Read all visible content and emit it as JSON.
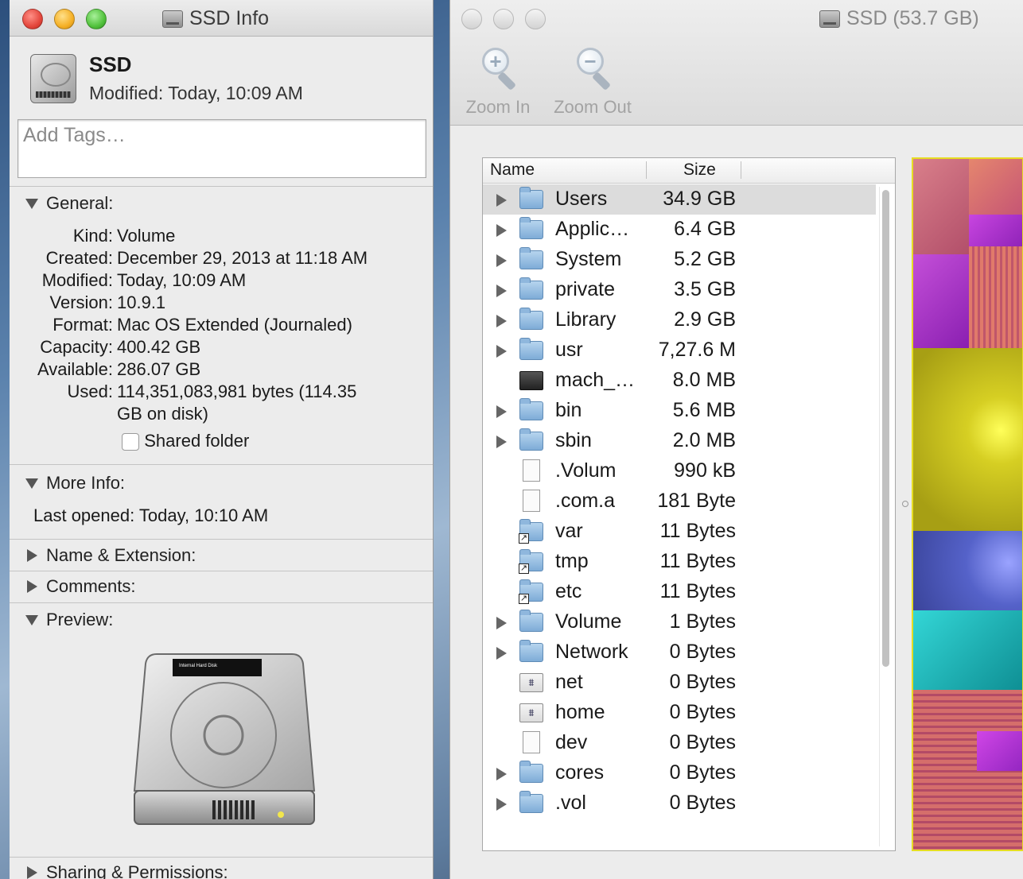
{
  "info_window": {
    "title": "SSD Info",
    "name": "SSD",
    "modified_header": "Modified: Today, 10:09 AM",
    "tags_placeholder": "Add Tags…",
    "general": {
      "heading": "General:",
      "rows": [
        {
          "key": "Kind:",
          "value": "Volume"
        },
        {
          "key": "Created:",
          "value": "December 29, 2013 at 11:18 AM"
        },
        {
          "key": "Modified:",
          "value": "Today, 10:09 AM"
        },
        {
          "key": "Version:",
          "value": "10.9.1"
        },
        {
          "key": "Format:",
          "value": "Mac OS Extended (Journaled)"
        },
        {
          "key": "Capacity:",
          "value": "400.42 GB"
        },
        {
          "key": "Available:",
          "value": "286.07 GB"
        },
        {
          "key": "Used:",
          "value": "114,351,083,981 bytes (114.35"
        },
        {
          "key": "",
          "value": "GB on disk)"
        }
      ],
      "shared_folder_label": "Shared folder"
    },
    "more_info": {
      "heading": "More Info:",
      "last_opened": "Last opened: Today, 10:10 AM"
    },
    "name_extension_heading": "Name & Extension:",
    "comments_heading": "Comments:",
    "preview_heading": "Preview:",
    "preview_disk_label": "Internal Hard Disk",
    "sharing_heading": "Sharing & Permissions:"
  },
  "disk_window": {
    "title": "SSD (53.7 GB)",
    "toolbar": {
      "zoom_in": "Zoom In",
      "zoom_out": "Zoom Out"
    },
    "columns": {
      "name": "Name",
      "size": "Size"
    },
    "rows": [
      {
        "name": "Users",
        "size": "34.9 GB",
        "icon": "users-folder-icon",
        "expandable": true
      },
      {
        "name": "Applic…",
        "size": "6.4 GB",
        "icon": "applications-folder-icon",
        "expandable": true
      },
      {
        "name": "System",
        "size": "5.2 GB",
        "icon": "system-folder-icon",
        "expandable": true
      },
      {
        "name": "private",
        "size": "3.5 GB",
        "icon": "folder-icon",
        "expandable": true
      },
      {
        "name": "Library",
        "size": "2.9 GB",
        "icon": "library-folder-icon",
        "expandable": true
      },
      {
        "name": "usr",
        "size": "7,27.6 M",
        "icon": "folder-icon",
        "expandable": true
      },
      {
        "name": "mach_…",
        "size": "8.0 MB",
        "icon": "executable-icon",
        "expandable": false
      },
      {
        "name": "bin",
        "size": "5.6 MB",
        "icon": "folder-icon",
        "expandable": true
      },
      {
        "name": "sbin",
        "size": "2.0 MB",
        "icon": "folder-icon",
        "expandable": true
      },
      {
        "name": ".Volum",
        "size": "990 kB",
        "icon": "volume-icon-file-icon",
        "expandable": false
      },
      {
        "name": ".com.a",
        "size": "181 Byte",
        "icon": "document-icon",
        "expandable": false
      },
      {
        "name": "var",
        "size": "11 Bytes",
        "icon": "alias-folder-icon",
        "expandable": false
      },
      {
        "name": "tmp",
        "size": "11 Bytes",
        "icon": "alias-folder-icon",
        "expandable": false
      },
      {
        "name": "etc",
        "size": "11 Bytes",
        "icon": "alias-folder-icon",
        "expandable": false
      },
      {
        "name": "Volume",
        "size": "1 Bytes",
        "icon": "folder-icon",
        "expandable": true
      },
      {
        "name": "Network",
        "size": "0 Bytes",
        "icon": "folder-icon",
        "expandable": true
      },
      {
        "name": "net",
        "size": "0 Bytes",
        "icon": "network-share-icon",
        "expandable": false
      },
      {
        "name": "home",
        "size": "0 Bytes",
        "icon": "network-share-icon",
        "expandable": false
      },
      {
        "name": "dev",
        "size": "0 Bytes",
        "icon": "document-icon",
        "expandable": false
      },
      {
        "name": "cores",
        "size": "0 Bytes",
        "icon": "folder-icon",
        "expandable": true
      },
      {
        "name": ".vol",
        "size": "0 Bytes",
        "icon": "folder-icon",
        "expandable": true
      }
    ],
    "selected_row": "Users",
    "treemap_colors": [
      "#c05f75",
      "#b13ad6",
      "#c9c21a",
      "#5060c8",
      "#1fc4c4",
      "#d06a66"
    ]
  }
}
